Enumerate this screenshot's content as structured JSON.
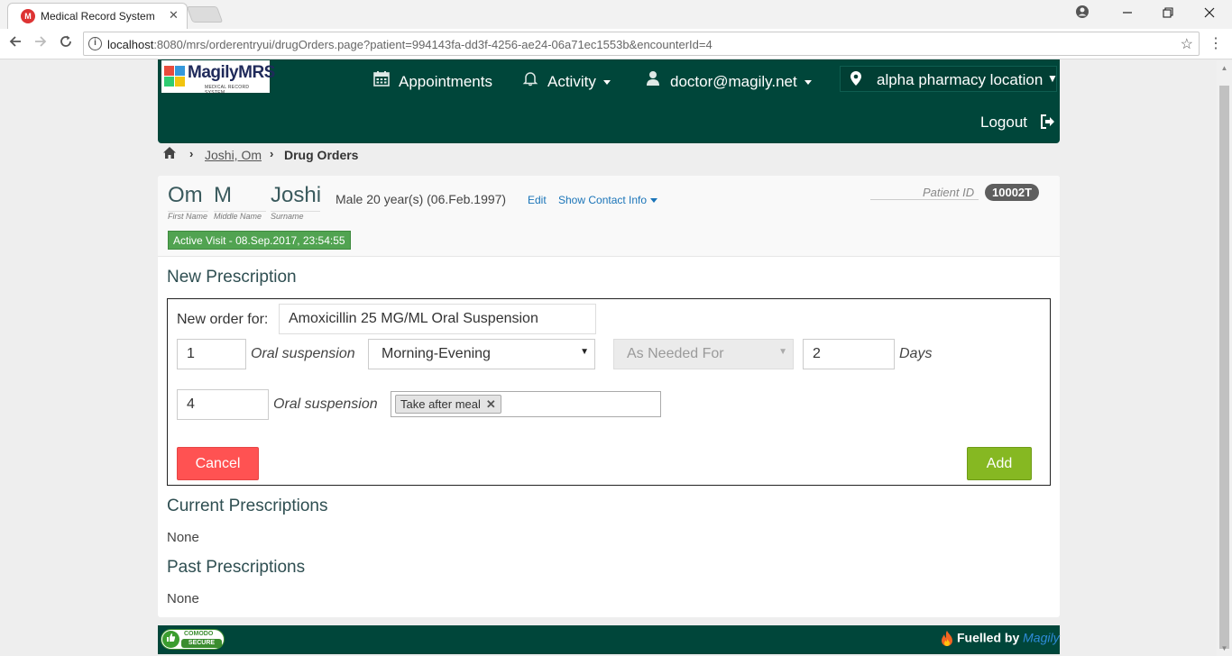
{
  "browser": {
    "tab_title": "Medical Record System",
    "tab_close": "✕",
    "favicon_text": "M",
    "url_host": "localhost",
    "url_rest": ":8080/mrs/orderentryui/drugOrders.page?patient=994143fa-dd3f-4256-ae24-06a71ec1553b&encounterId=4"
  },
  "header": {
    "logo_text": "MagilyMRS",
    "logo_subtitle": "MEDICAL RECORD SYSTEM",
    "appointments_label": "Appointments",
    "activity_label": "Activity",
    "user_label": "doctor@magily.net",
    "location_label": "alpha pharmacy location",
    "logout_label": "Logout"
  },
  "breadcrumb": {
    "patient_link": "Joshi, Om",
    "current": "Drug Orders"
  },
  "patient": {
    "first_name": "Om",
    "middle_name": "M",
    "surname": "Joshi",
    "first_name_label": "First Name",
    "middle_name_label": "Middle Name",
    "surname_label": "Surname",
    "gender_age": "Male  20 year(s) (06.Feb.1997)",
    "edit_link": "Edit",
    "contact_link": "Show Contact Info",
    "patient_id_label": "Patient ID",
    "patient_id": "10002T",
    "active_visit": "Active Visit - 08.Sep.2017, 23:54:55"
  },
  "new_prescription": {
    "title": "New Prescription",
    "order_label": "New order for:",
    "drug_value": "Amoxicillin 25 MG/ML Oral Suspension",
    "dose_value": "1",
    "dose_unit": "Oral suspension",
    "frequency_value": "Morning-Evening",
    "as_needed_value": "As Needed For",
    "duration_value": "2",
    "duration_unit": "Days",
    "quantity_value": "4",
    "quantity_unit": "Oral suspension",
    "instruction_tag": "Take after meal",
    "cancel_label": "Cancel",
    "add_label": "Add"
  },
  "current_prescriptions": {
    "title": "Current Prescriptions",
    "value": "None"
  },
  "past_prescriptions": {
    "title": "Past Prescriptions",
    "value": "None"
  },
  "footer": {
    "comodo_top": "COMODO",
    "comodo_bottom": "SECURE",
    "fuelled_by": "Fuelled by ",
    "brand": "Magily"
  },
  "colors": {
    "header_bg": "#00463a",
    "active_visit_bg": "#51a351",
    "cancel_bg": "#ff5252",
    "add_bg": "#86b822",
    "link": "#1a74b8"
  },
  "icons": [
    "calendar-icon",
    "bell-icon",
    "user-icon",
    "map-pin-icon",
    "logout-icon",
    "home-icon",
    "flame-icon",
    "thumbs-up-icon"
  ]
}
